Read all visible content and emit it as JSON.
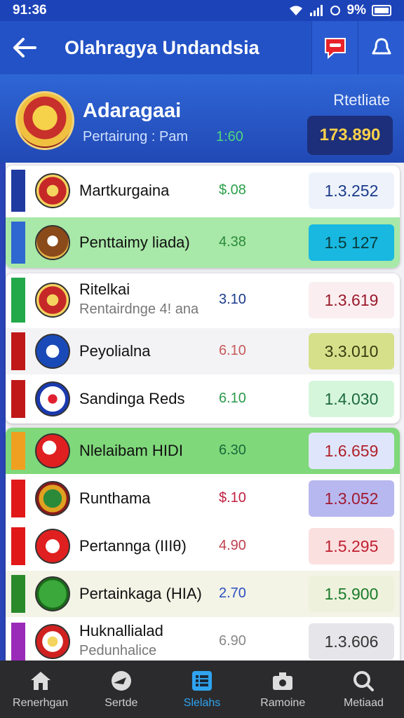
{
  "status_bar": {
    "time": "91:36",
    "battery": "9%"
  },
  "app_bar": {
    "title": "Olahragya Undandsia"
  },
  "header": {
    "title": "Adaragaai",
    "subtitle": "Pertairung : Pam",
    "subtitle_value": "1:60",
    "right_label": "Rtetliate",
    "total": "173.890"
  },
  "rows": [
    {
      "name": "Martkurgaina",
      "sub": "",
      "change": "$.08",
      "price": "1.3.252",
      "accent": "#1f3aa0",
      "change_color": "#2aa04a",
      "price_color": "#1a3a8a",
      "price_bg": "#eef3fb",
      "row_bg": "#ffffff",
      "logo": "crest-red"
    },
    {
      "name": "Penttaimy liada)",
      "sub": "",
      "change": "4.38",
      "price": "1.5 127",
      "accent": "#2f68d0",
      "change_color": "#2a8a3a",
      "price_color": "#0a3a3a",
      "price_bg": "#18b8e0",
      "row_bg": "#a8e8a8",
      "logo": "crest-brown"
    },
    {
      "name": "Ritelkai",
      "sub": "Rentairdnge 4! ana",
      "change": "3.10",
      "price": "1.3.619",
      "accent": "#23a84a",
      "change_color": "#1a3a8a",
      "price_color": "#9a1a2a",
      "price_bg": "#fbeef0",
      "row_bg": "#ffffff",
      "logo": "crest-red"
    },
    {
      "name": "Peyolialna",
      "sub": "",
      "change": "6.10",
      "price": "3.3.010",
      "accent": "#c01818",
      "change_color": "#c85a5a",
      "price_color": "#3a3a10",
      "price_bg": "#d6e08a",
      "row_bg": "#f3f3f5",
      "logo": "blue-shield"
    },
    {
      "name": "Sandinga Reds",
      "sub": "",
      "change": "6.10",
      "price": "1.4.030",
      "accent": "#c01818",
      "change_color": "#2a9a4a",
      "price_color": "#1a6a3a",
      "price_bg": "#d6f6dc",
      "row_bg": "#ffffff",
      "logo": "blue-ring"
    },
    {
      "name": "Nlelaibam HIDI",
      "sub": "",
      "change": "6.30",
      "price": "1.6.659",
      "accent": "#f0a020",
      "change_color": "#1a6a3a",
      "price_color": "#b0202a",
      "price_bg": "#dfe6fb",
      "row_bg": "#7fd87a",
      "logo": "red-swirl"
    },
    {
      "name": "Runthama",
      "sub": "",
      "change": "$.10",
      "price": "1.3.052",
      "accent": "#e01818",
      "change_color": "#c02040",
      "price_color": "#a01a30",
      "price_bg": "#b8b8f0",
      "row_bg": "#ffffff",
      "logo": "green-warrior"
    },
    {
      "name": "Pertannga (IIIθ)",
      "sub": "",
      "change": "4.90",
      "price": "1.5.295",
      "accent": "#e01818",
      "change_color": "#c04050",
      "price_color": "#c02030",
      "price_bg": "#fbe0e0",
      "row_bg": "#ffffff",
      "logo": "red-figure"
    },
    {
      "name": "Pertainkaga (HIA)",
      "sub": "",
      "change": "2.70",
      "price": "1.5.900",
      "accent": "#2a8a2a",
      "change_color": "#2a50c0",
      "price_color": "#1a7a2a",
      "price_bg": "#eef2dc",
      "row_bg": "#f3f3e6",
      "logo": "green-runner"
    },
    {
      "name": "Huknallialad",
      "sub": "Pedunhalice",
      "change": "6.90",
      "price": "1.3.606",
      "accent": "#9a2ab8",
      "change_color": "#888888",
      "price_color": "#333333",
      "price_bg": "#e6e6ea",
      "row_bg": "#ffffff",
      "logo": "red-crest-small"
    }
  ],
  "bottom_nav": [
    {
      "label": "Renerhgan",
      "icon": "home-icon",
      "active": false
    },
    {
      "label": "Sertde",
      "icon": "ball-icon",
      "active": false
    },
    {
      "label": "Slelahs",
      "icon": "list-icon",
      "active": true
    },
    {
      "label": "Ramoine",
      "icon": "camera-icon",
      "active": false
    },
    {
      "label": "Metiaad",
      "icon": "search-icon",
      "active": false
    }
  ]
}
